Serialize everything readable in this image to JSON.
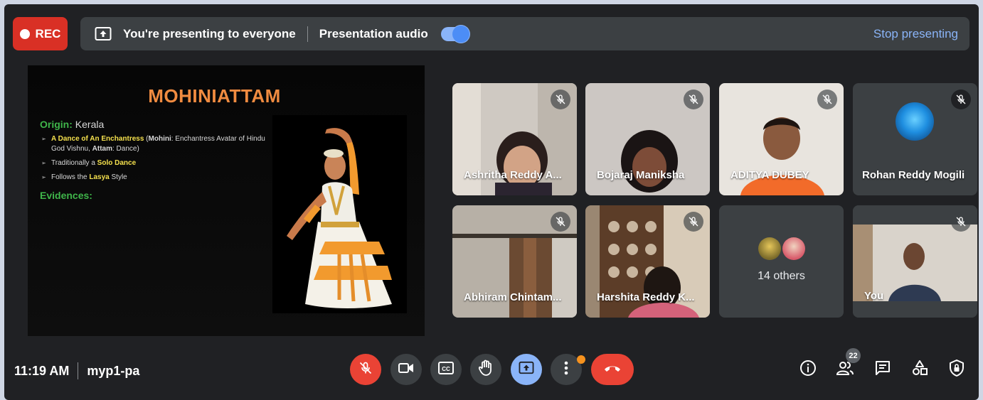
{
  "recording": {
    "label": "REC"
  },
  "presenting_bar": {
    "status_text": "You're presenting to everyone",
    "audio_label": "Presentation audio",
    "audio_enabled": true,
    "stop_label": "Stop presenting"
  },
  "slide": {
    "title": "MOHINIATTAM",
    "origin_label": "Origin:",
    "origin_value": "Kerala",
    "bullets": [
      {
        "highlight": "A Dance of An Enchantress",
        "rest_a": " (",
        "bold_a": "Mohini",
        "rest_b": ": Enchantress Avatar of Hindu God Vishnu, ",
        "bold_b": "Attam",
        "rest_c": ": Dance)"
      },
      {
        "pre": "Traditionally a ",
        "highlight": "Solo Dance"
      },
      {
        "pre": "Follows the ",
        "highlight": "Lasya",
        "post": " Style"
      }
    ],
    "evidences_label": "Evidences:"
  },
  "participants": [
    {
      "name": "Ashritha Reddy A...",
      "muted": true
    },
    {
      "name": "Bojaraj Maniksha",
      "muted": true
    },
    {
      "name": "ADITYA DUBEY",
      "muted": true
    },
    {
      "name": "Rohan Reddy Mogili",
      "muted": true
    },
    {
      "name": "Abhiram Chintam...",
      "muted": true
    },
    {
      "name": "Harshita Reddy K...",
      "muted": true
    },
    {
      "name": "14 others",
      "muted": false
    },
    {
      "name": "You",
      "muted": true
    }
  ],
  "bottom_bar": {
    "time": "11:19 AM",
    "meeting_code": "myp1-pa",
    "people_count": "22"
  },
  "colors": {
    "background": "#202124",
    "rec_red": "#d93025",
    "accent_blue": "#8ab4f8",
    "end_call_red": "#ea4335",
    "slide_title_orange": "#f08b40"
  },
  "icons": {
    "controls": [
      "mic-off-icon",
      "camera-icon",
      "captions-icon",
      "raise-hand-icon",
      "present-icon",
      "more-options-icon",
      "end-call-icon"
    ],
    "right": [
      "info-icon",
      "people-icon",
      "chat-icon",
      "activities-icon",
      "host-controls-icon"
    ]
  }
}
